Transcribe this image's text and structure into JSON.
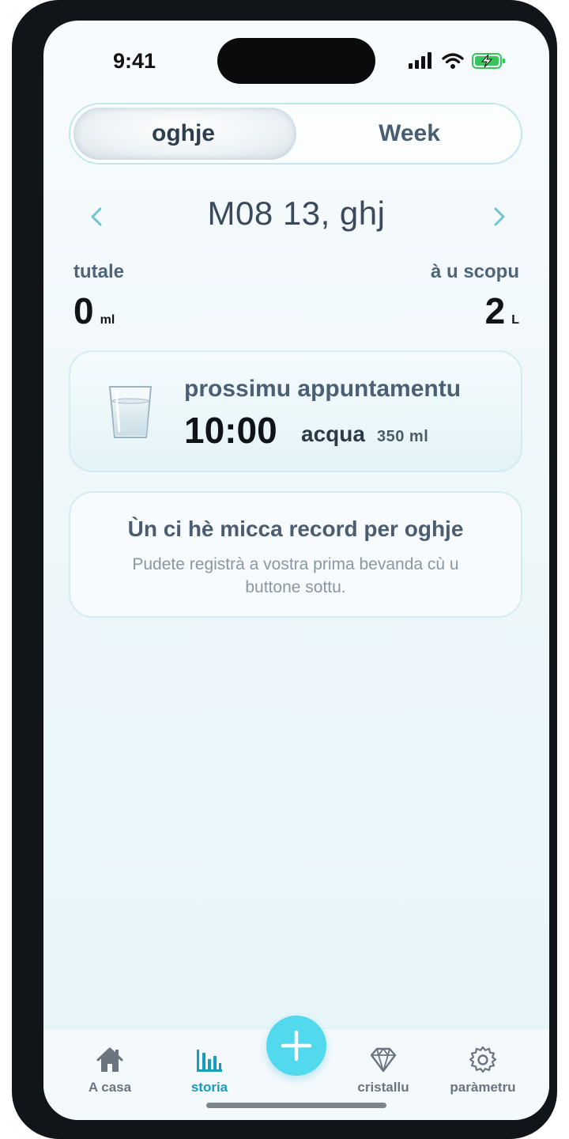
{
  "status": {
    "time": "9:41"
  },
  "segmented": {
    "today": "oghje",
    "week": "Week"
  },
  "date_nav": {
    "title": "M08 13, ghj"
  },
  "totals": {
    "total_label": "tutale",
    "total_value": "0",
    "total_unit": "ml",
    "goal_label": "à u scopu",
    "goal_value": "2",
    "goal_unit": "L"
  },
  "next_reminder": {
    "title": "prossimu appuntamentu",
    "time": "10:00",
    "drink": "acqua",
    "amount": "350 ml"
  },
  "empty_state": {
    "title": "Ùn ci hè micca record per oghje",
    "subtitle": "Pudete registrà a vostra prima bevanda cù u buttone sottu."
  },
  "tabbar": {
    "home": "A casa",
    "history": "storia",
    "crystal": "cristallu",
    "settings": "paràmetru",
    "active": "history"
  },
  "colors": {
    "accent": "#52d9ee",
    "active_tab": "#1b9bbb",
    "battery": "#34c759"
  },
  "icons": [
    "signal-icon",
    "wifi-icon",
    "battery-charging-icon",
    "chevron-left-icon",
    "chevron-right-icon",
    "water-glass-icon",
    "home-icon",
    "bar-chart-icon",
    "plus-icon",
    "diamond-icon",
    "gear-icon"
  ]
}
